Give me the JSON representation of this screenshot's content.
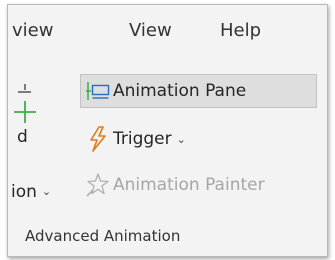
{
  "ribbon": {
    "tabs": [
      {
        "label": "view"
      },
      {
        "label": "View"
      },
      {
        "label": "Help"
      }
    ],
    "group": {
      "label": "Advanced Animation",
      "add_animation": {
        "line1": "d",
        "line2": "ion",
        "icon": "add-animation-plus-icon"
      },
      "buttons": {
        "animation_pane": {
          "label": "Animation Pane",
          "icon": "animation-pane-icon"
        },
        "trigger": {
          "label": "Trigger",
          "icon": "lightning-icon"
        },
        "animation_painter": {
          "label": "Animation Painter",
          "icon": "star-brush-icon",
          "enabled": false
        }
      }
    }
  },
  "colors": {
    "ribbon_bg": "#f3f3f3",
    "selected_button_bg": "#dedede",
    "accent_green": "#3fae49",
    "lightning_orange": "#e07a1a",
    "disabled_text": "#a6a6a6"
  }
}
